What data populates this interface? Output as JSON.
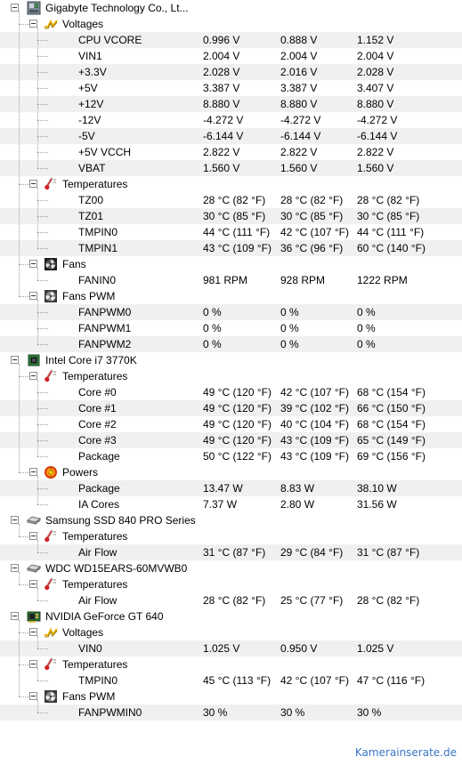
{
  "devices": [
    {
      "name": "Gigabyte Technology Co., Lt...",
      "icon": "motherboard-icon",
      "groups": [
        {
          "name": "Voltages",
          "icon": "voltage-icon",
          "sensors": [
            {
              "name": "CPU VCORE",
              "value": "0.996 V",
              "min": "0.888 V",
              "max": "1.152 V"
            },
            {
              "name": "VIN1",
              "value": "2.004 V",
              "min": "2.004 V",
              "max": "2.004 V"
            },
            {
              "name": "+3.3V",
              "value": "2.028 V",
              "min": "2.016 V",
              "max": "2.028 V"
            },
            {
              "name": "+5V",
              "value": "3.387 V",
              "min": "3.387 V",
              "max": "3.407 V"
            },
            {
              "name": "+12V",
              "value": "8.880 V",
              "min": "8.880 V",
              "max": "8.880 V"
            },
            {
              "name": "-12V",
              "value": "-4.272 V",
              "min": "-4.272 V",
              "max": "-4.272 V"
            },
            {
              "name": "-5V",
              "value": "-6.144 V",
              "min": "-6.144 V",
              "max": "-6.144 V"
            },
            {
              "name": "+5V VCCH",
              "value": "2.822 V",
              "min": "2.822 V",
              "max": "2.822 V"
            },
            {
              "name": "VBAT",
              "value": "1.560 V",
              "min": "1.560 V",
              "max": "1.560 V"
            }
          ]
        },
        {
          "name": "Temperatures",
          "icon": "thermometer-icon",
          "sensors": [
            {
              "name": "TZ00",
              "value": "28 °C  (82 °F)",
              "min": "28 °C  (82 °F)",
              "max": "28 °C  (82 °F)"
            },
            {
              "name": "TZ01",
              "value": "30 °C  (85 °F)",
              "min": "30 °C  (85 °F)",
              "max": "30 °C  (85 °F)"
            },
            {
              "name": "TMPIN0",
              "value": "44 °C  (111 °F)",
              "min": "42 °C  (107 °F)",
              "max": "44 °C  (111 °F)"
            },
            {
              "name": "TMPIN1",
              "value": "43 °C  (109 °F)",
              "min": "36 °C  (96 °F)",
              "max": "60 °C  (140 °F)"
            }
          ]
        },
        {
          "name": "Fans",
          "icon": "fan-icon",
          "sensors": [
            {
              "name": "FANIN0",
              "value": "981 RPM",
              "min": "928 RPM",
              "max": "1222 RPM"
            }
          ]
        },
        {
          "name": "Fans PWM",
          "icon": "fan-pwm-icon",
          "sensors": [
            {
              "name": "FANPWM0",
              "value": "0 %",
              "min": "0 %",
              "max": "0 %"
            },
            {
              "name": "FANPWM1",
              "value": "0 %",
              "min": "0 %",
              "max": "0 %"
            },
            {
              "name": "FANPWM2",
              "value": "0 %",
              "min": "0 %",
              "max": "0 %"
            }
          ]
        }
      ]
    },
    {
      "name": "Intel Core i7 3770K",
      "icon": "cpu-icon",
      "groups": [
        {
          "name": "Temperatures",
          "icon": "thermometer-icon",
          "sensors": [
            {
              "name": "Core #0",
              "value": "49 °C  (120 °F)",
              "min": "42 °C  (107 °F)",
              "max": "68 °C  (154 °F)"
            },
            {
              "name": "Core #1",
              "value": "49 °C  (120 °F)",
              "min": "39 °C  (102 °F)",
              "max": "66 °C  (150 °F)"
            },
            {
              "name": "Core #2",
              "value": "49 °C  (120 °F)",
              "min": "40 °C  (104 °F)",
              "max": "68 °C  (154 °F)"
            },
            {
              "name": "Core #3",
              "value": "49 °C  (120 °F)",
              "min": "43 °C  (109 °F)",
              "max": "65 °C  (149 °F)"
            },
            {
              "name": "Package",
              "value": "50 °C  (122 °F)",
              "min": "43 °C  (109 °F)",
              "max": "69 °C  (156 °F)"
            }
          ]
        },
        {
          "name": "Powers",
          "icon": "power-icon",
          "sensors": [
            {
              "name": "Package",
              "value": "13.47 W",
              "min": "8.83 W",
              "max": "38.10 W"
            },
            {
              "name": "IA Cores",
              "value": "7.37 W",
              "min": "2.80 W",
              "max": "31.56 W"
            }
          ]
        }
      ]
    },
    {
      "name": "Samsung SSD 840 PRO Series",
      "icon": "drive-icon",
      "groups": [
        {
          "name": "Temperatures",
          "icon": "thermometer-icon",
          "sensors": [
            {
              "name": "Air Flow",
              "value": "31 °C  (87 °F)",
              "min": "29 °C  (84 °F)",
              "max": "31 °C  (87 °F)"
            }
          ]
        }
      ]
    },
    {
      "name": "WDC WD15EARS-60MVWB0",
      "icon": "drive-icon",
      "groups": [
        {
          "name": "Temperatures",
          "icon": "thermometer-icon",
          "sensors": [
            {
              "name": "Air Flow",
              "value": "28 °C  (82 °F)",
              "min": "25 °C  (77 °F)",
              "max": "28 °C  (82 °F)"
            }
          ]
        }
      ]
    },
    {
      "name": "NVIDIA GeForce GT 640",
      "icon": "gpu-icon",
      "groups": [
        {
          "name": "Voltages",
          "icon": "voltage-icon",
          "sensors": [
            {
              "name": "VIN0",
              "value": "1.025 V",
              "min": "0.950 V",
              "max": "1.025 V"
            }
          ]
        },
        {
          "name": "Temperatures",
          "icon": "thermometer-icon",
          "sensors": [
            {
              "name": "TMPIN0",
              "value": "45 °C  (113 °F)",
              "min": "42 °C  (107 °F)",
              "max": "47 °C  (116 °F)"
            }
          ]
        },
        {
          "name": "Fans PWM",
          "icon": "fan-pwm-icon",
          "sensors": [
            {
              "name": "FANPWMIN0",
              "value": "30 %",
              "min": "30 %",
              "max": "30 %"
            }
          ]
        }
      ]
    }
  ],
  "watermark": "Kamerainserate.de",
  "colors": {
    "alt_row": "#f0f0f0",
    "watermark": "#3a76c6",
    "voltage": "#e8b400",
    "thermometer": "#d42020",
    "power": "#e87000"
  }
}
